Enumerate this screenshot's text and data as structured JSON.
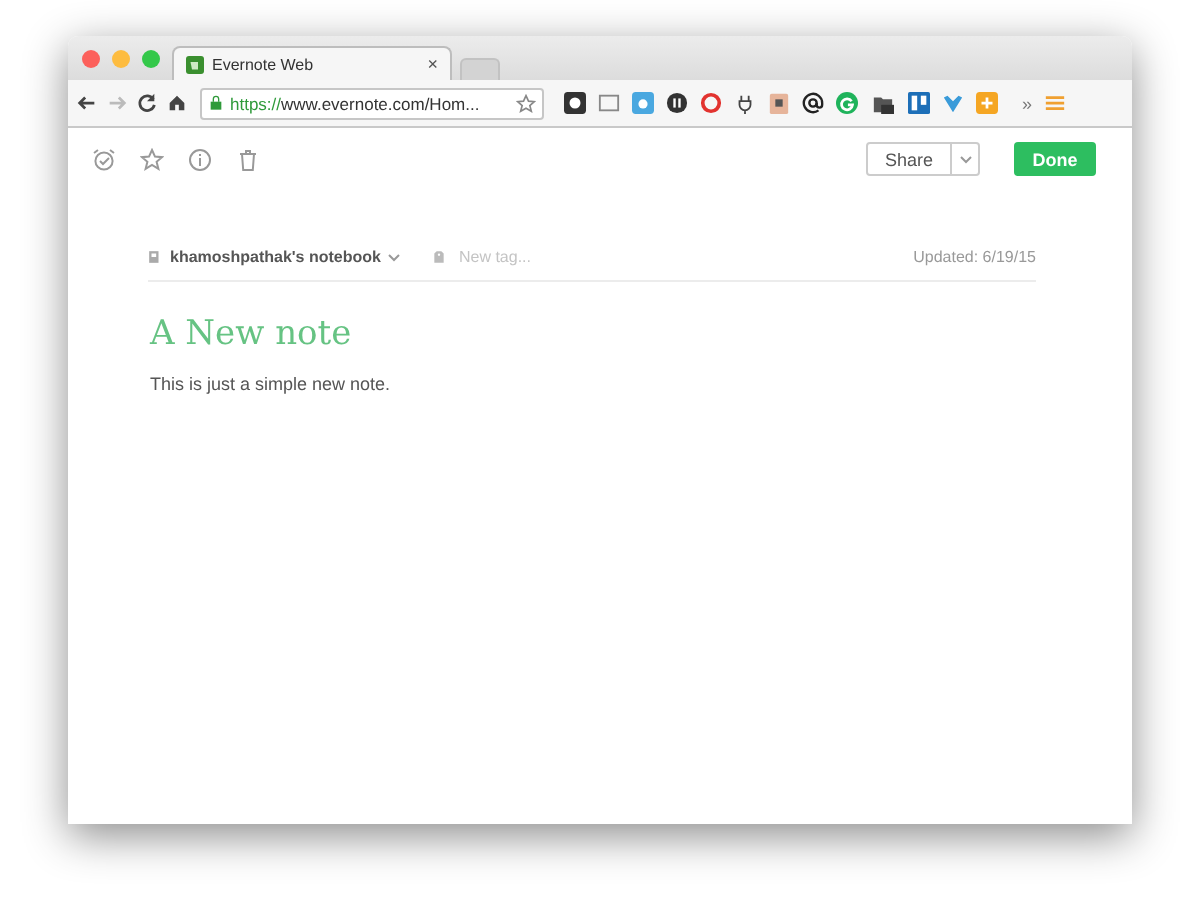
{
  "browser": {
    "tab_title": "Evernote Web",
    "tab_close": "×",
    "url_scheme": "https://",
    "url_rest": "www.evernote.com/Hom...",
    "overflow": "»"
  },
  "note_toolbar": {
    "share": "Share",
    "done": "Done"
  },
  "note": {
    "notebook": "khamoshpathak's notebook",
    "tag_placeholder": "New tag...",
    "updated": "Updated: 6/19/15",
    "title": "A New note",
    "body": "This is just a simple new note."
  }
}
